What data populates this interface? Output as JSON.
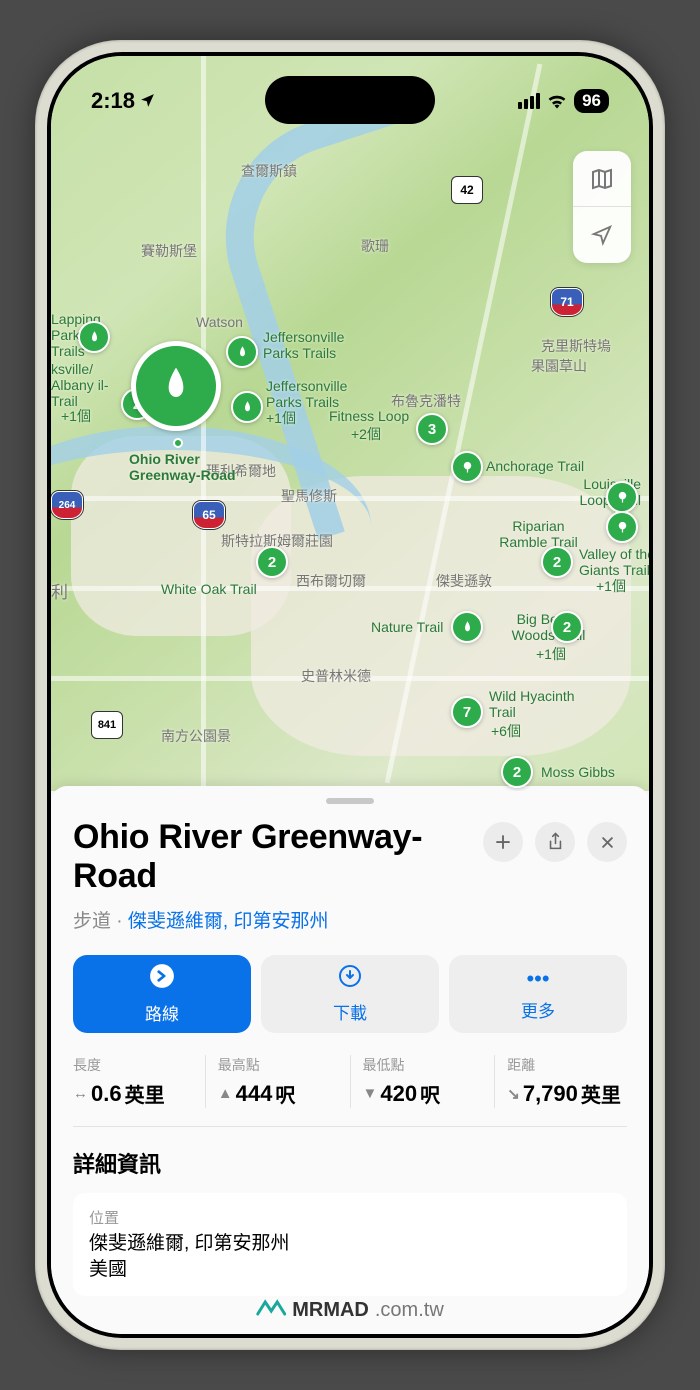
{
  "status": {
    "time": "2:18",
    "battery": "96"
  },
  "place": {
    "title": "Ohio River Greenway-Road",
    "category": "步道",
    "location_link": "傑斐遜維爾, 印第安那州"
  },
  "actions": {
    "directions": "路線",
    "download": "下載",
    "more": "更多"
  },
  "stats": {
    "length_label": "長度",
    "length_value": "0.6",
    "length_unit": "英里",
    "high_label": "最高點",
    "high_value": "444",
    "high_unit": "呎",
    "low_label": "最低點",
    "low_value": "420",
    "low_unit": "呎",
    "dist_label": "距離",
    "dist_value": "7,790",
    "dist_unit": "英里"
  },
  "details": {
    "section_title": "詳細資訊",
    "location_label": "位置",
    "location_line1": "傑斐遜維爾, 印第安那州",
    "location_line2": "美國"
  },
  "map_labels": {
    "charlestown": "查爾斯鎮",
    "sellersburg": "賽勒斯堡",
    "keshan": "歌珊",
    "watson": "Watson",
    "crestwood": "克里斯特塢",
    "guoyuan": "果園草山",
    "brooklyn": "布魯克潘特",
    "malixu": "瑪利希爾地",
    "shengma": "聖馬修斯",
    "stlas": "斯特拉斯姆爾莊園",
    "xibuer": "西布爾切爾",
    "jeffersun": "傑斐遜敦",
    "shipinyin": "史普林米德",
    "nanfang": "南方公園景",
    "li": "利"
  },
  "trails": {
    "lapping": "Lapping Park Trails",
    "jeff1": "Jeffersonville Parks Trails",
    "jeff2": "Jeffersonville Parks Trails",
    "jeff2_extra": "+1個",
    "ksville": "ksville/ Albany il-Trail",
    "ksville_extra": "+1個",
    "ohio": "Ohio River Greenway-Road",
    "fitness": "Fitness Loop",
    "fitness_extra": "+2個",
    "anchorage": "Anchorage Trail",
    "louisville": "Louisville Loop Trail",
    "riparian": "Riparian Ramble Trail",
    "valley": "Valley of the Giants Trail",
    "valley_extra": "+1個",
    "whiteoak": "White Oak Trail",
    "nature": "Nature Trail",
    "bigbeech": "Big Beech Woods Trail",
    "bigbeech_extra": "+1個",
    "wildhyacinth": "Wild Hyacinth Trail",
    "wildhyacinth_extra": "+6個",
    "mossgibbs": "Moss Gibbs"
  },
  "highways": {
    "42": "42",
    "71": "71",
    "264": "264",
    "65": "65",
    "841": "841"
  },
  "watermark": {
    "brand": "MRMAD",
    "domain": ".com.tw"
  }
}
